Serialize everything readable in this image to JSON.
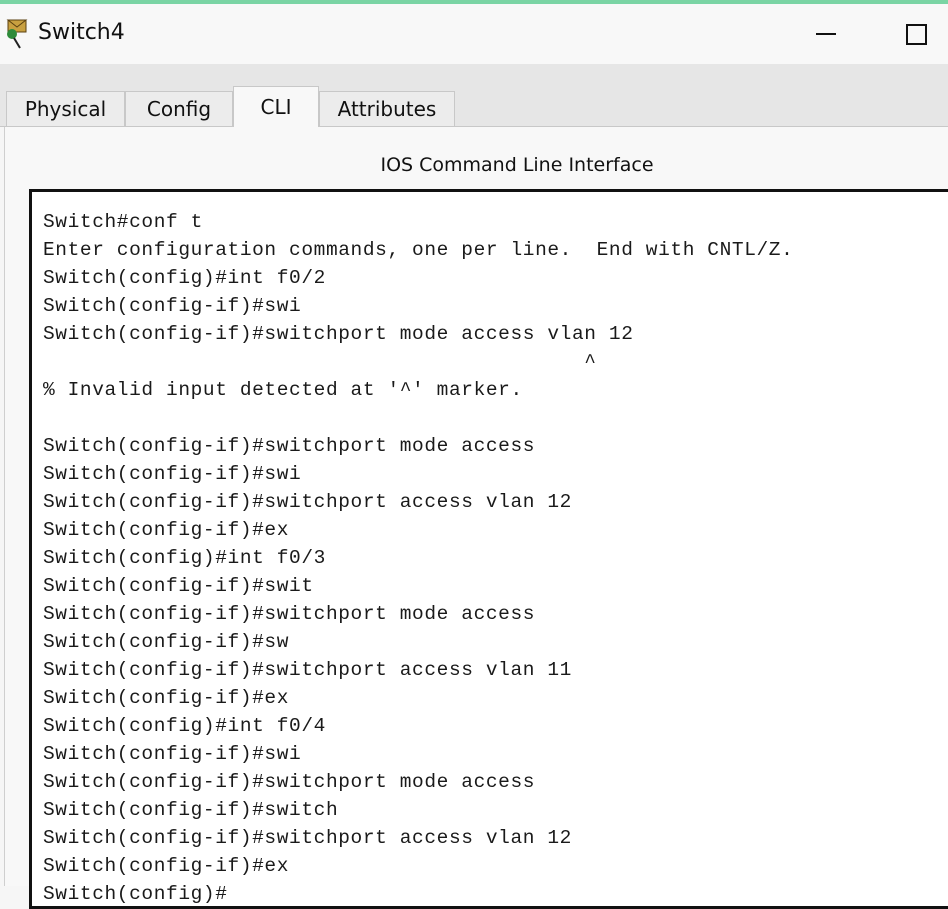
{
  "window": {
    "title": "Switch4",
    "app_icon": "packet-tracer-switch-icon",
    "controls": {
      "minimize": "minimize-icon",
      "maximize": "maximize-icon"
    }
  },
  "tabs": [
    {
      "label": "Physical",
      "active": false
    },
    {
      "label": "Config",
      "active": false
    },
    {
      "label": "CLI",
      "active": true
    },
    {
      "label": "Attributes",
      "active": false
    }
  ],
  "cli": {
    "heading": "IOS Command Line Interface",
    "lines": [
      "Switch#conf t",
      "Enter configuration commands, one per line.  End with CNTL/Z.",
      "Switch(config)#int f0/2",
      "Switch(config-if)#swi",
      "Switch(config-if)#switchport mode access vlan 12",
      "                                            ^",
      "% Invalid input detected at '^' marker.",
      "",
      "Switch(config-if)#switchport mode access",
      "Switch(config-if)#swi",
      "Switch(config-if)#switchport access vlan 12",
      "Switch(config-if)#ex",
      "Switch(config)#int f0/3",
      "Switch(config-if)#swit",
      "Switch(config-if)#switchport mode access",
      "Switch(config-if)#sw",
      "Switch(config-if)#switchport access vlan 11",
      "Switch(config-if)#ex",
      "Switch(config)#int f0/4",
      "Switch(config-if)#swi",
      "Switch(config-if)#switchport mode access",
      "Switch(config-if)#switch",
      "Switch(config-if)#switchport access vlan 12",
      "Switch(config-if)#ex",
      "Switch(config)#"
    ]
  }
}
